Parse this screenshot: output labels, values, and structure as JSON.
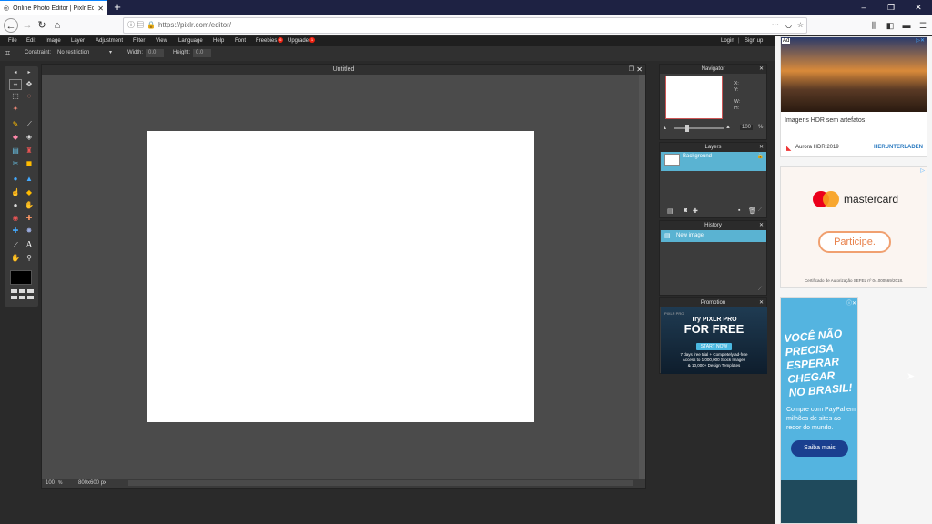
{
  "browser": {
    "tab_title": "Online Photo Editor | Pixlr Edit",
    "url": "https://pixlr.com/editor/"
  },
  "menu": {
    "items": [
      "File",
      "Edit",
      "Image",
      "Layer",
      "Adjustment",
      "Filter",
      "View",
      "Language",
      "Help",
      "Font"
    ],
    "freebies": "Freebies",
    "freebies_badge": "6",
    "upgrade": "Upgrade",
    "upgrade_badge": "1",
    "login": "Login",
    "signup": "Sign up"
  },
  "toolopts": {
    "constraint_label": "Constraint:",
    "constraint_value": "No restriction",
    "width_label": "Width:",
    "width_value": "0.0",
    "height_label": "Height:",
    "height_value": "0.0"
  },
  "document": {
    "title": "Untitled",
    "zoom": "100",
    "size": "800x600 px"
  },
  "navigator": {
    "title": "Navigator",
    "x_label": "X:",
    "y_label": "Y:",
    "w_label": "W:",
    "h_label": "H:",
    "zoom": "100"
  },
  "layers": {
    "title": "Layers",
    "items": [
      "Background"
    ]
  },
  "history": {
    "title": "History",
    "items": [
      "New image"
    ]
  },
  "promotion": {
    "title": "Promotion",
    "brand": "PIXLR PRO",
    "line1": "Try PIXLR PRO",
    "line2": "FOR FREE",
    "button": "START NOW",
    "line3": "7 days free trial + Completely ad-free",
    "line4": "Access to 1,000,000 Stock Images",
    "line5": "& 10,000+ Design Templates"
  },
  "ads": {
    "ad_label": "Ad",
    "ad1_text": "Imagens HDR sem artefatos",
    "ad1_brand": "Aurora HDR 2019",
    "ad1_cta": "HERUNTERLADEN",
    "ad2_brand": "mastercard",
    "ad2_cta": "Participe.",
    "ad2_note": "Certificado de Autorização SEFEL nº 04.000569/2018.",
    "ad3_headline": [
      "VOCÊ NÃO",
      "PRECISA",
      "ESPERAR",
      "CHEGAR",
      "NO BRASIL!"
    ],
    "ad3_body": "Compre com PayPal em milhões de sites ao redor do mundo.",
    "ad3_cta": "Saiba mais"
  }
}
